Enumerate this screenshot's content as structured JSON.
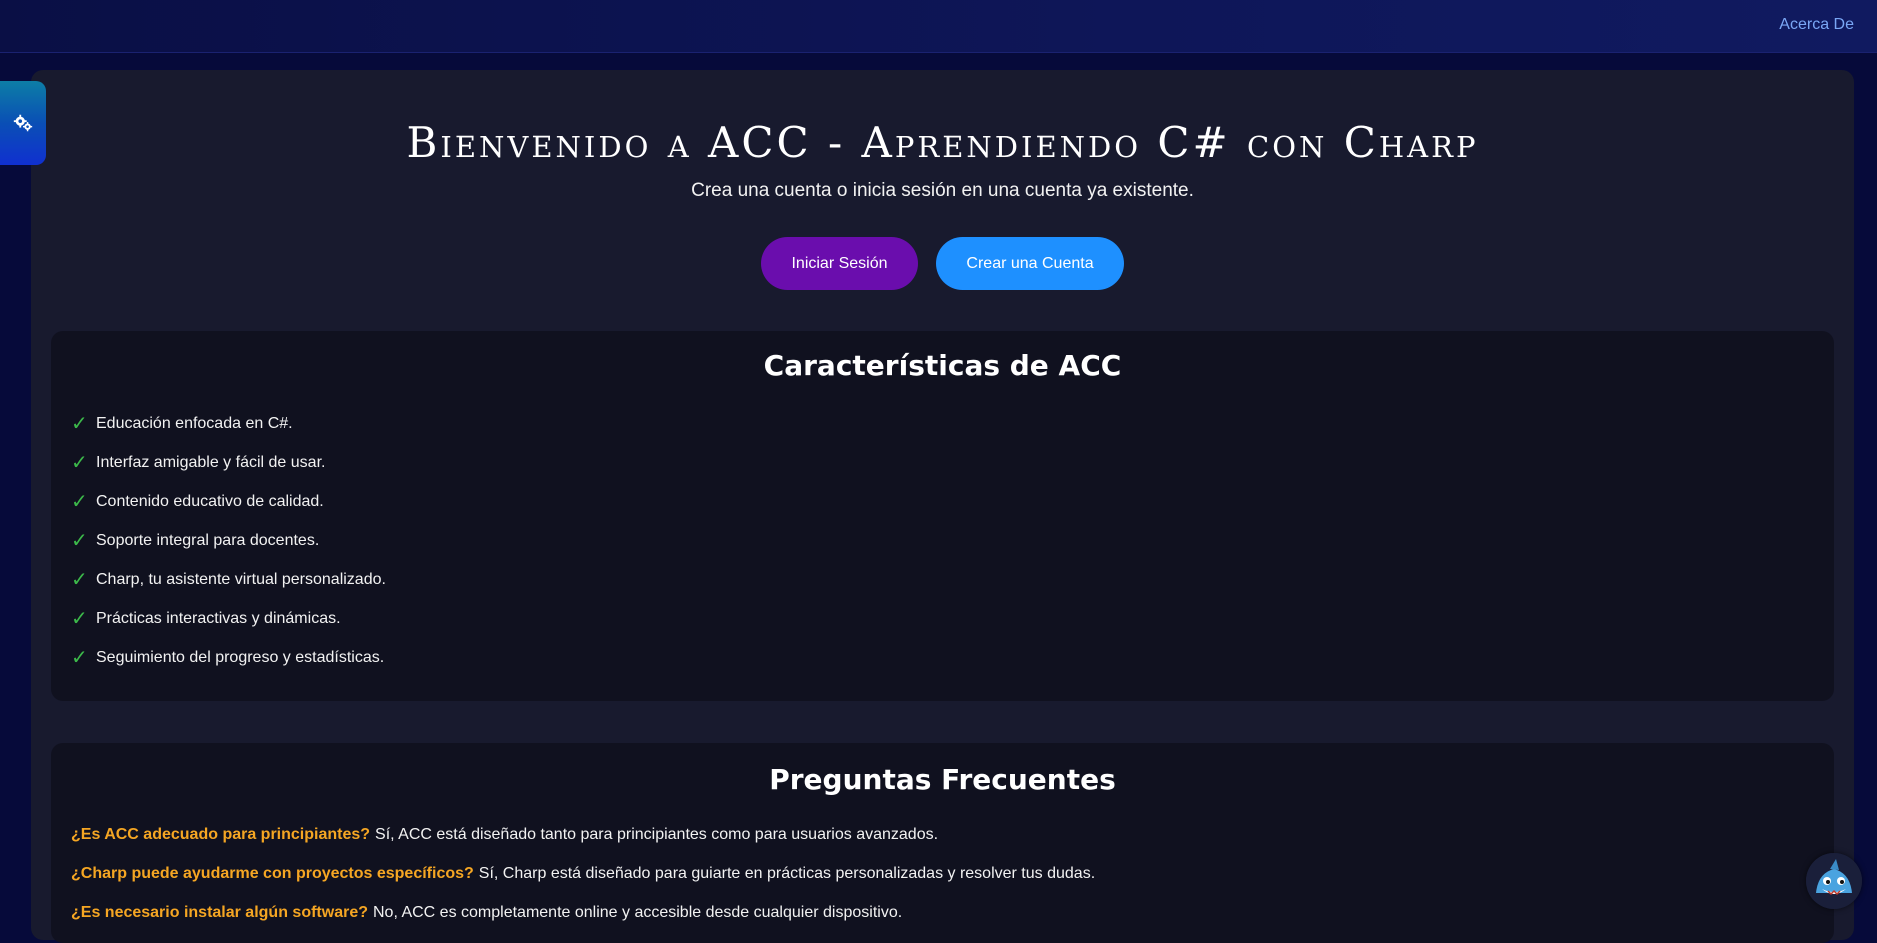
{
  "nav": {
    "about_label": "Acerca De"
  },
  "sidebar": {
    "toggle_icon": "gears-icon"
  },
  "hero": {
    "title": "Bienvenido a ACC - Aprendiendo C# con Charp",
    "subtitle": "Crea una cuenta o inicia sesión en una cuenta ya existente.",
    "login_label": "Iniciar Sesión",
    "signup_label": "Crear una Cuenta"
  },
  "features": {
    "title": "Características de ACC",
    "check_glyph": "✓",
    "items": [
      "Educación enfocada en C#.",
      "Interfaz amigable y fácil de usar.",
      "Contenido educativo de calidad.",
      "Soporte integral para docentes.",
      "Charp, tu asistente virtual personalizado.",
      "Prácticas interactivas y dinámicas.",
      "Seguimiento del progreso y estadísticas."
    ]
  },
  "faq": {
    "title": "Preguntas Frecuentes",
    "items": [
      {
        "q": "¿Es ACC adecuado para principiantes?",
        "a": "Sí, ACC está diseñado tanto para principiantes como para usuarios avanzados."
      },
      {
        "q": "¿Charp puede ayudarme con proyectos específicos?",
        "a": "Sí, Charp está diseñado para guiarte en prácticas personalizadas y resolver tus dudas."
      },
      {
        "q": "¿Es necesario instalar algún software?",
        "a": "No, ACC es completamente online y accesible desde cualquier dispositivo."
      }
    ]
  },
  "assistant": {
    "avatar_icon": "shark-mascot-icon"
  },
  "colors": {
    "background": "#060a3a",
    "panel": "#181a2e",
    "card": "#10111f",
    "login_button": "#6a0dad",
    "signup_button": "#1e90ff",
    "check": "#3cb94a",
    "faq_question": "#f5a623",
    "nav_link": "#7aa7f5"
  }
}
